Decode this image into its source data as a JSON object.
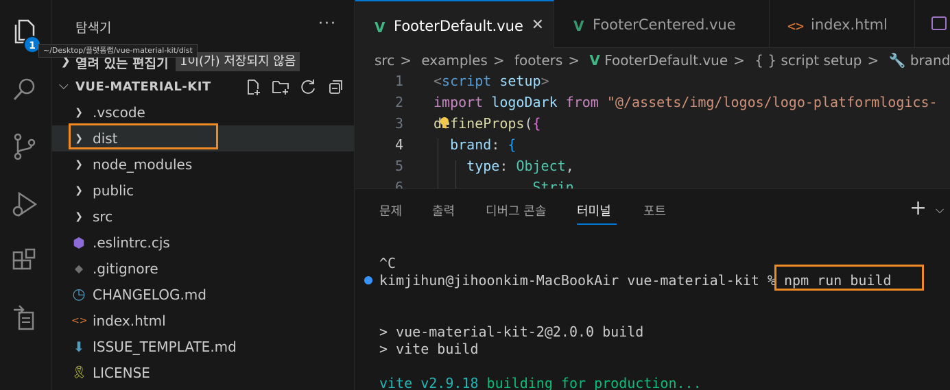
{
  "activity_bar": {
    "badge": "1",
    "items": [
      "explorer-icon",
      "search-icon",
      "source-control-icon",
      "run-debug-icon",
      "extensions-icon",
      "remote-explorer-icon"
    ]
  },
  "sidebar": {
    "title": "탐색기",
    "more": "···",
    "tooltip": "~/Desktop/플랫폼랩/vue-material-kit/dist",
    "open_editors": {
      "label": "열려 있는 편집기",
      "unsaved": "1이(가) 저장되지 않음"
    },
    "project": "VUE-MATERIAL-KIT",
    "tree": [
      {
        "label": ".vscode",
        "icon": "chevron-right-icon"
      },
      {
        "label": "dist",
        "icon": "chevron-right-icon"
      },
      {
        "label": "node_modules",
        "icon": "chevron-right-icon"
      },
      {
        "label": "public",
        "icon": "chevron-right-icon"
      },
      {
        "label": "src",
        "icon": "chevron-right-icon"
      },
      {
        "label": ".eslintrc.cjs",
        "icon": "eslint-icon"
      },
      {
        "label": ".gitignore",
        "icon": "git-icon"
      },
      {
        "label": "CHANGELOG.md",
        "icon": "clock-icon"
      },
      {
        "label": "index.html",
        "icon": "html-icon"
      },
      {
        "label": "ISSUE_TEMPLATE.md",
        "icon": "arrow-down-icon"
      },
      {
        "label": "LICENSE",
        "icon": "license-icon"
      }
    ]
  },
  "editor": {
    "tabs": [
      {
        "label": "FooterDefault.vue",
        "active": true
      },
      {
        "label": "FooterCentered.vue",
        "active": false
      },
      {
        "label": "index.html",
        "active": false
      }
    ],
    "close": "✕",
    "breadcrumb": [
      "src",
      "examples",
      "footers",
      "FooterDefault.vue",
      "{ } script setup",
      "brand"
    ],
    "lines": [
      {
        "n": "1",
        "parts": [
          [
            "tag",
            "<"
          ],
          [
            "kw",
            "script"
          ],
          [
            "plain",
            " "
          ],
          [
            "var",
            "setup"
          ],
          [
            "tag",
            ">"
          ]
        ]
      },
      {
        "n": "2",
        "parts": [
          [
            "kw2",
            "import"
          ],
          [
            "plain",
            " "
          ],
          [
            "var",
            "logoDark"
          ],
          [
            "plain",
            " "
          ],
          [
            "kw2",
            "from"
          ],
          [
            "plain",
            " "
          ],
          [
            "str",
            "\"@/assets/img/logos/logo-platformlogics-"
          ]
        ]
      },
      {
        "n": "3",
        "parts": [
          [
            "fn",
            "defineProps"
          ],
          [
            "plain",
            "("
          ],
          [
            "brace",
            "{"
          ]
        ]
      },
      {
        "n": "4",
        "parts": [
          [
            "plain",
            "  "
          ],
          [
            "var",
            "brand"
          ],
          [
            "plain",
            ": "
          ],
          [
            "brace2",
            "{"
          ]
        ]
      },
      {
        "n": "5",
        "parts": [
          [
            "plain",
            "    "
          ],
          [
            "var",
            "type"
          ],
          [
            "plain",
            ": "
          ],
          [
            "cls",
            "Object"
          ],
          [
            "plain",
            ","
          ]
        ]
      },
      {
        "n": "6",
        "parts": [
          [
            "plain",
            "            "
          ],
          [
            "cls",
            "Strin"
          ]
        ]
      }
    ]
  },
  "panel": {
    "tabs": [
      "문제",
      "출력",
      "디버그 콘솔",
      "터미널",
      "포트"
    ],
    "active_tab": "터미널",
    "plus": "+",
    "chevron": "⌵",
    "terminal": {
      "interrupt": "^C",
      "prompt": "kimjihun@jihoonkim-MacBookAir vue-material-kit % ",
      "command": "npm run build",
      "out1": "> vue-material-kit-2@2.0.0 build",
      "out2": "> vite build",
      "vite_prefix": "vite v2.9.18 ",
      "vite_rest": "building for production..."
    }
  }
}
